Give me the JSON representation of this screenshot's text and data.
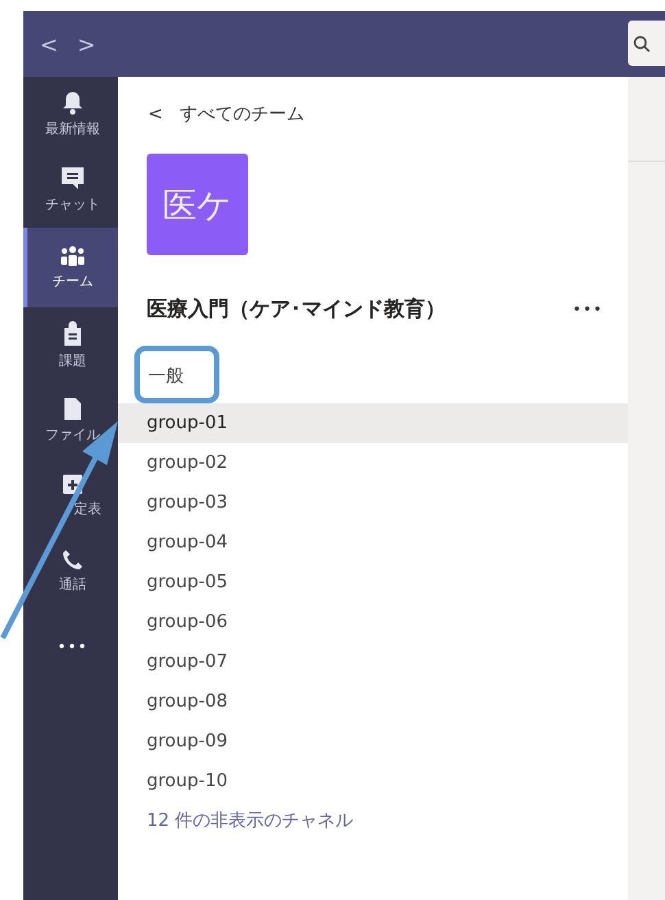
{
  "nav": {
    "back": "<",
    "forward": ">"
  },
  "rail": [
    {
      "kind": "bell",
      "label": "最新情報",
      "selected": false
    },
    {
      "kind": "chat",
      "label": "チャット",
      "selected": false
    },
    {
      "kind": "team",
      "label": "チーム",
      "selected": true
    },
    {
      "kind": "bag",
      "label": "課題",
      "selected": false
    },
    {
      "kind": "file",
      "label": "ファイル",
      "selected": false
    },
    {
      "kind": "calendar",
      "label": "定表",
      "selected": false
    },
    {
      "kind": "phone",
      "label": "通話",
      "selected": false
    },
    {
      "kind": "more",
      "label": "•••",
      "selected": false
    }
  ],
  "team": {
    "back_link": "すべてのチーム",
    "back_icon": "<",
    "avatar": "医ケ",
    "name": "医療入門（ケア･マインド教育）",
    "more": "•••"
  },
  "channels": [
    {
      "name": "一般",
      "selected": false,
      "highlighted": true
    },
    {
      "name": "group-01",
      "selected": true
    },
    {
      "name": "group-02",
      "selected": false
    },
    {
      "name": "group-03",
      "selected": false
    },
    {
      "name": "group-04",
      "selected": false
    },
    {
      "name": "group-05",
      "selected": false
    },
    {
      "name": "group-06",
      "selected": false
    },
    {
      "name": "group-07",
      "selected": false
    },
    {
      "name": "group-08",
      "selected": false
    },
    {
      "name": "group-09",
      "selected": false
    },
    {
      "name": "group-10",
      "selected": false
    }
  ],
  "hidden_channels": "12 件の非表示のチャネル"
}
